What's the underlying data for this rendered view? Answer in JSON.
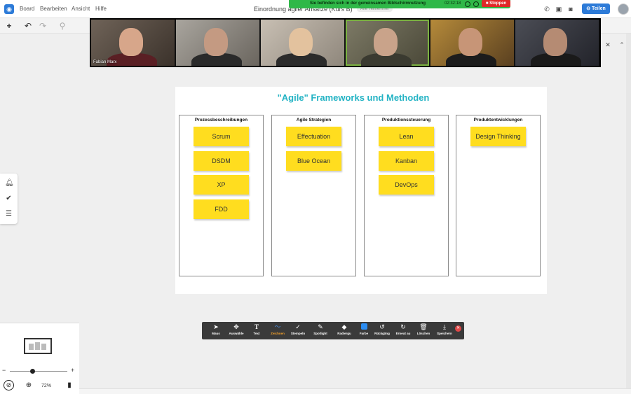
{
  "menu": {
    "app_icon": "chat-bubble-logo-icon",
    "items": [
      {
        "label": "Board"
      },
      {
        "label": "Bearbeiten"
      },
      {
        "label": "Ansicht"
      },
      {
        "label": "Hilfe"
      }
    ]
  },
  "board": {
    "title": "Einordnung agiler Ansätze (Kurs B)",
    "badge": "Alle Teilnehmer"
  },
  "screen_share": {
    "message": "Sie befinden sich in der gemeinsamen Bildschirmnutzung",
    "timer": "02:32:18",
    "stop_label": "Stoppen",
    "color": "#2fb848",
    "stop_color": "#e02828"
  },
  "header_right": {
    "icons": [
      "phone-icon",
      "camera-icon",
      "chat-icon"
    ],
    "share_label": "Teilen",
    "accent": "#2d7bd8"
  },
  "video": {
    "participants": [
      {
        "name": "Fabian Marx"
      },
      {
        "name": ""
      },
      {
        "name": ""
      },
      {
        "name": ""
      },
      {
        "name": ""
      },
      {
        "name": ""
      }
    ]
  },
  "canvas": {
    "heading": "\"Agile\" Frameworks und Methoden",
    "heading_color": "#23b3c4",
    "sticky_color": "#ffdd1f",
    "columns": [
      {
        "title": "Prozessbeschreibungen",
        "notes": [
          "Scrum",
          "DSDM",
          "XP",
          "FDD"
        ]
      },
      {
        "title": "Agile Strategien",
        "notes": [
          "Effectuation",
          "Blue Ocean"
        ]
      },
      {
        "title": "Produktionssteuerung",
        "notes": [
          "Lean",
          "Kanban",
          "DevOps"
        ]
      },
      {
        "title": "Produktentwicklungen",
        "notes": [
          "Design Thinking"
        ]
      }
    ]
  },
  "tools": [
    {
      "label": "Maus",
      "icon": "cursor-icon"
    },
    {
      "label": "Auswähle",
      "icon": "move-icon"
    },
    {
      "label": "Text",
      "icon": "text-icon"
    },
    {
      "label": "Zeichnen",
      "icon": "draw-icon",
      "active": true
    },
    {
      "label": "Stempeln",
      "icon": "stamp-icon"
    },
    {
      "label": "Spotlight",
      "icon": "spotlight-icon"
    },
    {
      "label": "Radiergu",
      "icon": "eraser-icon"
    },
    {
      "label": "Farbe",
      "icon": "color-icon"
    },
    {
      "label": "Rückgäng",
      "icon": "undo-icon"
    },
    {
      "label": "Erneut au",
      "icon": "redo-icon"
    },
    {
      "label": "Löschen",
      "icon": "trash-icon"
    },
    {
      "label": "Speichern",
      "icon": "save-icon"
    }
  ],
  "zoom": {
    "value": "72%",
    "minus": "−",
    "plus": "+",
    "level": 0.4
  }
}
